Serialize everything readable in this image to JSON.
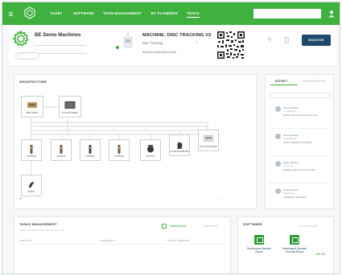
{
  "nav": {
    "items": [
      "FLEET",
      "SOFTWARE",
      "TEAM MANAGEMENT",
      "BY PLANNERS",
      "TRACK"
    ],
    "active_index": 4,
    "search_placeholder": ""
  },
  "header": {
    "machine_name": "BE Demo Machines",
    "machine_title": "MACHINE: DISC TRACKING V2",
    "machine_subtitle": "Disc Tracking",
    "machine_id": "5a9f12d4e6b8f01c33ea",
    "monitor_label": "MONITOR"
  },
  "architecture": {
    "title": "ARCHITECTURE",
    "top_nodes": [
      {
        "label": "IBRL DEMO",
        "icon": "controller-icon"
      },
      {
        "label": "TOUCHSCREEN",
        "icon": "monitor-icon"
      }
    ],
    "bottom_nodes": [
      {
        "label": "GRIPPER",
        "icon": "sensor-icon"
      },
      {
        "label": "SENSOR",
        "icon": "sensor-icon"
      },
      {
        "label": "CAMERA",
        "icon": "sensor-icon"
      },
      {
        "label": "GRIPPER",
        "icon": "sensor-icon"
      },
      {
        "label": "MOTOR",
        "icon": "motor-icon"
      },
      {
        "label": "ACCELEROMETER",
        "icon": "hand-icon"
      },
      {
        "label": "PRO SOFTWARE",
        "icon": "device-icon"
      },
      {
        "label": "ROBOT",
        "icon": "robot-icon"
      }
    ]
  },
  "activity": {
    "tabs": [
      "ACTIVITY",
      "DOCUMENTATION"
    ],
    "items": [
      {
        "name": "Kevin Hansen",
        "time": "2 minutes ago",
        "text": "Machine disc counter has been reset"
      },
      {
        "name": "Kevin Hansen",
        "time": "5 minutes ago",
        "text": "Sensor calibrated successfully"
      },
      {
        "name": "Kevin Hansen",
        "time": "1 hour ago",
        "text": "Software updated on the controller"
      },
      {
        "name": "Kevin Hansen",
        "time": "2 hours ago",
        "text": "Architecture node added"
      }
    ]
  },
  "tasks": {
    "title": "TASKS MANAGEMENT",
    "subtitle": "Create and assign tasks to the machine team",
    "tabs": [
      "OPEN TASKS",
      "COMPLETED"
    ],
    "columns": [
      "TASK TITLE",
      "ASSIGNED TO",
      "DATE OF CREATION"
    ]
  },
  "software": {
    "title": "SOFTWARE",
    "link_label": "ALL SOFTWARE",
    "cards": [
      "Dashboards Machine Export",
      "Dashboards Operator Terminal Export"
    ],
    "goto_label": "GO TO"
  },
  "colors": {
    "brand_green": "#3fb13f",
    "navy": "#1f4a6b"
  }
}
